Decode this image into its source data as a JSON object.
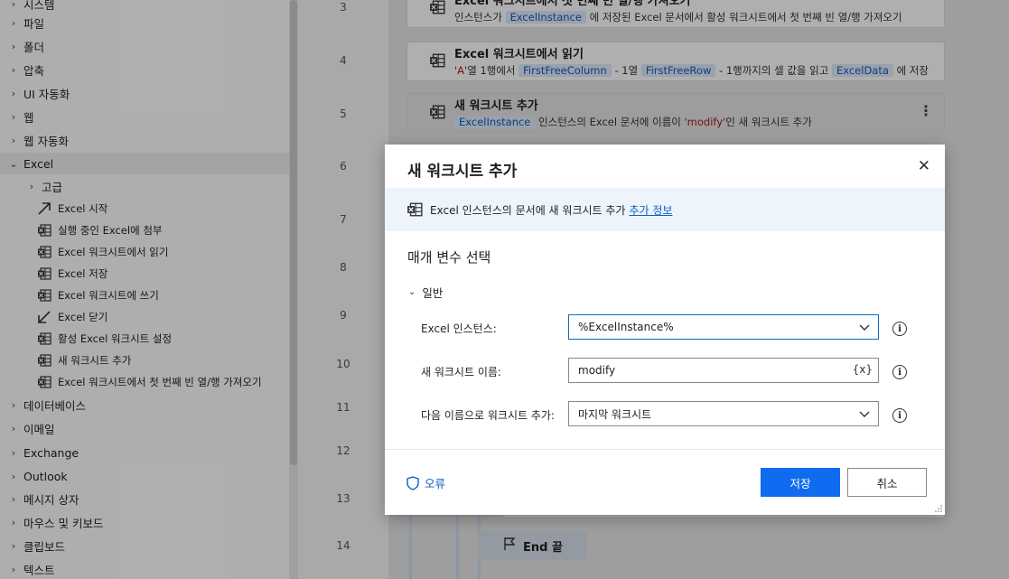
{
  "sidebar": {
    "cats_top": [
      "시스템",
      "파일",
      "폴더",
      "압축",
      "UI 자동화",
      "웹",
      "웹 자동화"
    ],
    "excel": {
      "label": "Excel",
      "sub": "고급",
      "actions": [
        {
          "label": "Excel 시작",
          "icon": "arrow-launch-icon"
        },
        {
          "label": "실행 중인 Excel에 첨부",
          "icon": "excel-sheet-icon"
        },
        {
          "label": "Excel 워크시트에서 읽기",
          "icon": "excel-sheet-icon"
        },
        {
          "label": "Excel 저장",
          "icon": "excel-sheet-icon"
        },
        {
          "label": "Excel 워크시트에 쓰기",
          "icon": "excel-sheet-icon"
        },
        {
          "label": "Excel 닫기",
          "icon": "arrow-close-icon"
        },
        {
          "label": "활성 Excel 워크시트 설정",
          "icon": "excel-sheet-icon"
        },
        {
          "label": "새 워크시트 추가",
          "icon": "excel-sheet-icon"
        },
        {
          "label": "Excel 워크시트에서 첫 번째 빈 열/행 가져오기",
          "icon": "excel-sheet-icon"
        }
      ]
    },
    "cats_bottom": [
      "데이터베이스",
      "이메일",
      "Exchange",
      "Outlook",
      "메시지 상자",
      "마우스 및 키보드",
      "클립보드",
      "텍스트"
    ]
  },
  "flow": {
    "line_numbers": [
      "3",
      "4",
      "5",
      "6",
      "7",
      "8",
      "9",
      "10",
      "11",
      "12",
      "13",
      "14"
    ],
    "step3": {
      "title": "Excel 워크시트에서 첫 번째 빈 열/행 가져오기",
      "d1": "인스턴스가",
      "tok1": "ExcelInstance",
      "d2": "에 저장된 Excel 문서에서 활성 워크시트에서 첫 번째 빈 열/행 가져오기"
    },
    "step4": {
      "title": "Excel 워크시트에서 읽기",
      "lit1": "'A'",
      "d1": "열 1행에서",
      "tok1": "FirstFreeColumn",
      "d2": "- 1열",
      "tok2": "FirstFreeRow",
      "d3": "- 1행까지의 셀 값을 읽고",
      "tok3": "ExcelData",
      "d4": "에 저장"
    },
    "step5": {
      "title": "새 워크시트 추가",
      "tok1": "ExcelInstance",
      "d1": "인스턴스의 Excel 문서에 이름이",
      "lit1": "'modify'",
      "d2": "인 새 워크시트 추가",
      "more": "⋮"
    },
    "end_label": "End 끝"
  },
  "dialog": {
    "title": "새 워크시트 추가",
    "close": "✕",
    "info_text": "Excel 인스턴스의 문서에 새 워크시트 추가",
    "info_link": "추가 정보",
    "section": "매개 변수 선택",
    "group": "일반",
    "fields": {
      "instance_label": "Excel 인스턴스:",
      "instance_value": "%ExcelInstance%",
      "name_label": "새 워크시트 이름:",
      "name_value": "modify",
      "name_var": "{x}",
      "pos_label": "다음 이름으로 워크시트 추가:",
      "pos_value": "마지막 워크시트"
    },
    "info_i": "i",
    "error_label": "오류",
    "save": "저장",
    "cancel": "취소"
  },
  "colors": {
    "accent": "#0f6cf0",
    "token_bg": "#dbe7f6",
    "token_fg": "#1359b8"
  }
}
